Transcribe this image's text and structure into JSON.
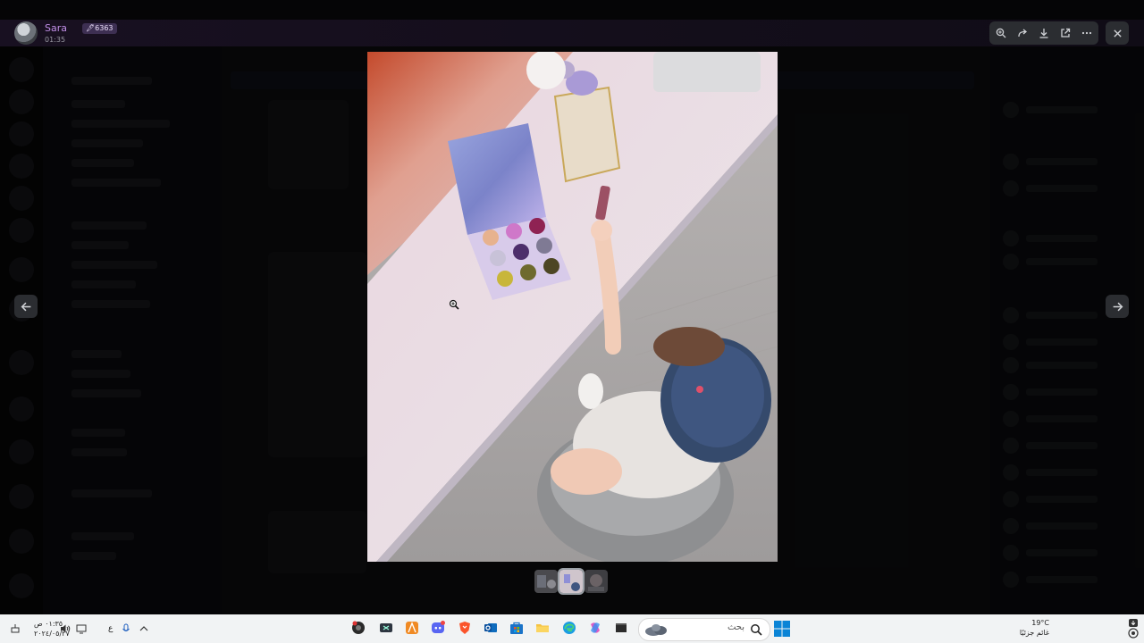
{
  "viewer": {
    "user": {
      "name": "Sara",
      "badge": "🖋6363",
      "time": "01:35"
    },
    "toolbar": {
      "icons": [
        "zoom-in-icon",
        "forward-icon",
        "download-icon",
        "open-external-icon",
        "more-icon"
      ],
      "close_icon": "close-icon"
    },
    "nav": {
      "prev_icon": "arrow-left-icon",
      "next_icon": "arrow-right-icon"
    },
    "thumbnails_count": 3,
    "selected_thumbnail": 2
  },
  "taskbar": {
    "clock_time": "٠١:٣٥ ص",
    "clock_date": "٢٠٢٤/٠٥/٢٧",
    "language": "ع",
    "search_placeholder": "بحث",
    "weather_temp": "19°C",
    "weather_desc": "غائم جزئيًا"
  },
  "colors": {
    "accent_name": "#c08ee6",
    "toolbar_bg": "#2b2d31",
    "taskbar_bg": "#f1f3f4"
  }
}
